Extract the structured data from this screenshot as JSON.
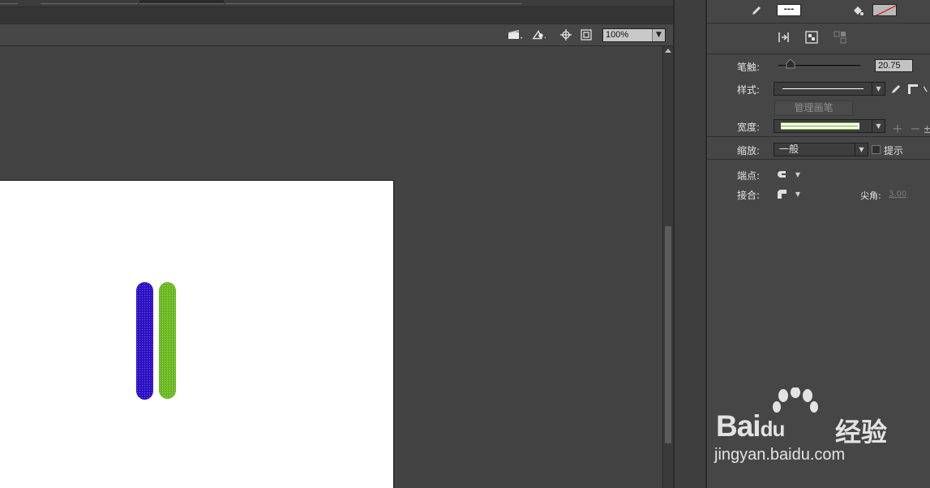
{
  "toolbar": {
    "zoom_value": "100%",
    "icons": [
      "clapperboard-icon",
      "symbol-icon",
      "center-stage-icon",
      "clip-stage-icon"
    ]
  },
  "stage": {
    "strokes": [
      {
        "name": "blue-stroke",
        "color": "#2b10c4"
      },
      {
        "name": "green-stroke",
        "color": "#6cb820"
      }
    ]
  },
  "properties": {
    "stroke_color_icon": "pencil-icon",
    "fill_color_icon": "paint-bucket-icon",
    "stroke_swatch_text": "---",
    "stroke_label": "笔触:",
    "stroke_value": "20.75",
    "stroke_slider_fraction": 0.1,
    "style_label": "样式:",
    "manage_brush_label": "管理画笔",
    "width_label": "宽度:",
    "scale_label": "缩放:",
    "scale_value": "一般",
    "hint_label": "提示",
    "cap_label": "端点:",
    "join_label": "接合:",
    "miter_label": "尖角:",
    "miter_value": "3.00"
  },
  "watermark": {
    "brand": "Bai",
    "brand_paw": "du",
    "product": "经验",
    "url": "jingyan.baidu.com"
  }
}
